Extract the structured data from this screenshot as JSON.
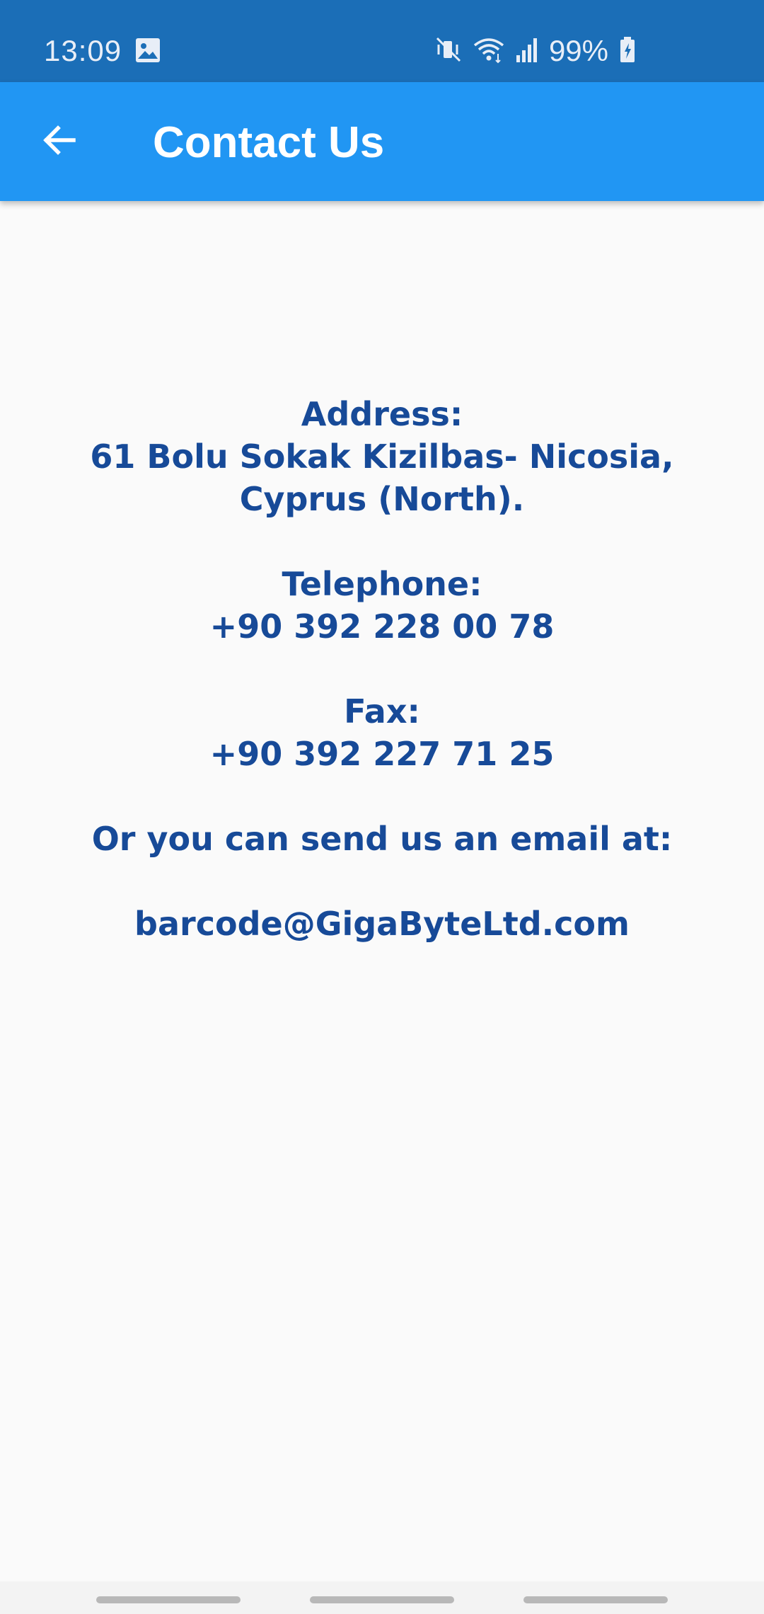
{
  "status_bar": {
    "time": "13:09",
    "battery_text": "99%",
    "icons": [
      "gallery-icon",
      "mute-vibrate-icon",
      "wifi-icon",
      "cell-signal-icon",
      "battery-charging-icon"
    ]
  },
  "app_bar": {
    "title": "Contact Us",
    "back_icon": "arrow-left-icon"
  },
  "contact": {
    "address_label": "Address:",
    "address_line1": "61 Bolu Sokak Kizilbas- Nicosia,",
    "address_line2": "Cyprus (North).",
    "telephone_label": "Telephone:",
    "telephone": "+90 392 228 00 78",
    "fax_label": "Fax:",
    "fax": "+90 392 227 71 25",
    "email_prompt": "Or you can send us an email at:",
    "email": "barcode@GigaByteLtd.com"
  },
  "colors": {
    "status_bar": "#1b6eb7",
    "app_bar": "#2196f3",
    "text": "#174a98",
    "background": "#fafafa"
  }
}
